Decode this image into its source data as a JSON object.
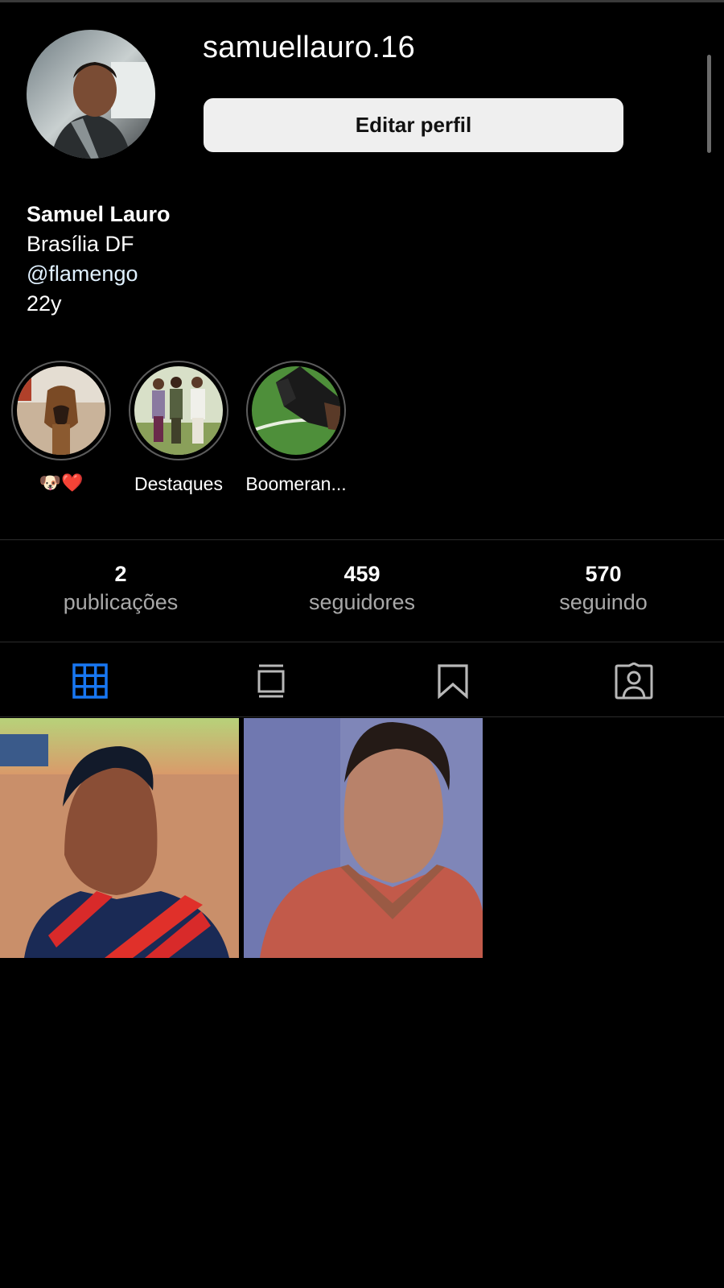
{
  "profile": {
    "username": "samuellauro.16",
    "edit_button_label": "Editar perfil",
    "full_name": "Samuel Lauro",
    "bio_lines": [
      "Brasília DF",
      "@flamengo",
      "22y"
    ]
  },
  "highlights": [
    {
      "label": "🐶❤️",
      "icon": "dog-highlight-image"
    },
    {
      "label": "Destaques",
      "icon": "group-photo-highlight-image"
    },
    {
      "label": "Boomeran...",
      "icon": "soccer-boot-highlight-image"
    }
  ],
  "stats": [
    {
      "value": "2",
      "label": "publicações"
    },
    {
      "value": "459",
      "label": "seguidores"
    },
    {
      "value": "570",
      "label": "seguindo"
    }
  ],
  "tabs": [
    {
      "name": "grid",
      "icon": "grid-icon",
      "active": true
    },
    {
      "name": "igtv",
      "icon": "igtv-icon",
      "active": false
    },
    {
      "name": "saved",
      "icon": "bookmark-icon",
      "active": false
    },
    {
      "name": "tagged",
      "icon": "tagged-person-icon",
      "active": false
    }
  ],
  "colors": {
    "background": "#000000",
    "active_tab": "#1877f2",
    "inactive_icon": "#b8b8b8",
    "button_bg": "#efefef",
    "secondary_text": "#a8a8a8"
  },
  "posts": [
    {
      "id": "post-1",
      "description": "selfie-striped-jersey"
    },
    {
      "id": "post-2",
      "description": "selfie-red-shirt"
    }
  ]
}
